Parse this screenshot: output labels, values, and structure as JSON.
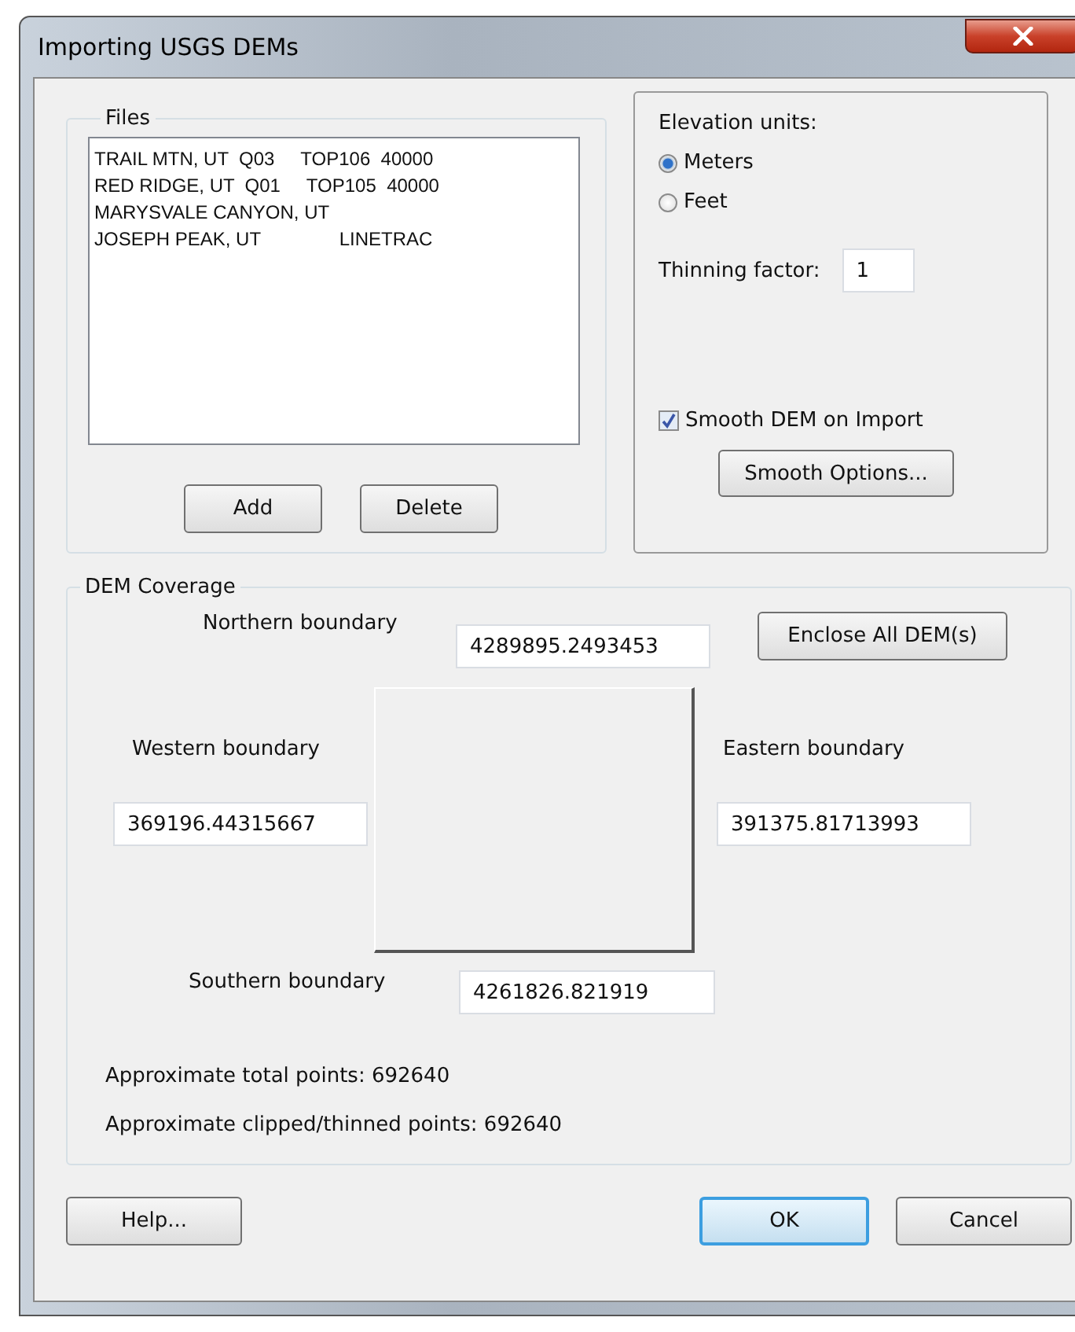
{
  "window": {
    "title": "Importing USGS DEMs"
  },
  "files": {
    "label": "Files",
    "rows": [
      "TRAIL MTN, UT  Q03     TOP106  40000",
      "RED RIDGE, UT  Q01     TOP105  40000",
      "MARYSVALE CANYON, UT",
      "JOSEPH PEAK, UT               LINETRAC"
    ],
    "buttons": [
      "Add",
      "Delete"
    ]
  },
  "options": {
    "elevation_label": "Elevation units:",
    "units": [
      {
        "label": "Meters",
        "selected": true
      },
      {
        "label": "Feet",
        "selected": false
      }
    ],
    "thinning": {
      "label": "Thinning factor:",
      "value": "1"
    },
    "smooth": {
      "label": "Smooth DEM on Import",
      "checked": true
    },
    "smooth_options_button": "Smooth Options..."
  },
  "coverage": {
    "label": "DEM Coverage",
    "north": {
      "label": "Northern boundary",
      "value": "4289895.2493453"
    },
    "enclose_button": "Enclose All DEM(s)",
    "west": {
      "label": "Western boundary",
      "value": "369196.44315667"
    },
    "east": {
      "label": "Eastern boundary",
      "value": "391375.81713993"
    },
    "south": {
      "label": "Southern boundary",
      "value": "4261826.821919"
    },
    "stats": [
      "Approximate total points: 692640",
      "Approximate clipped/thinned points: 692640"
    ]
  },
  "buttons": [
    {
      "label": "Help...",
      "default": false
    },
    {
      "label": "OK",
      "default": true
    },
    {
      "label": "Cancel",
      "default": false
    }
  ]
}
